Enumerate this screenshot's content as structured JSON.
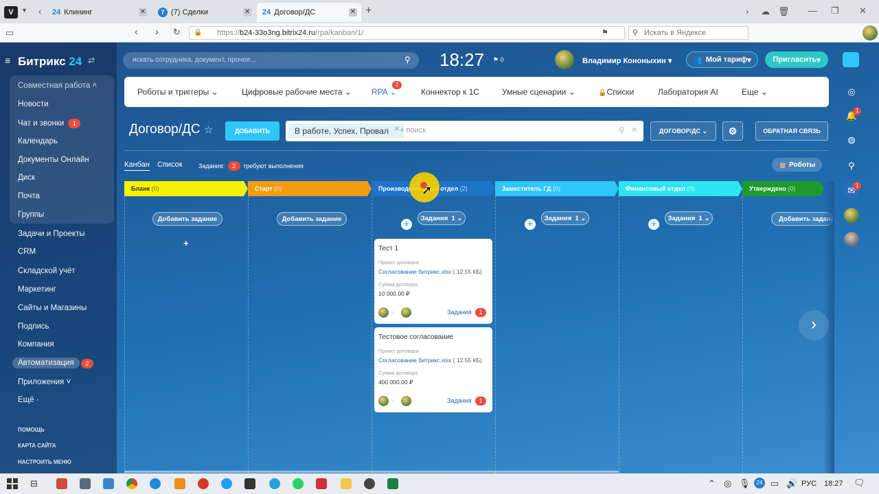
{
  "browser": {
    "tabs": [
      {
        "icon": "24",
        "label": "Клининг"
      },
      {
        "icon": "7",
        "label": "(7) Сделки"
      },
      {
        "icon": "24",
        "label": "Договор/ДС"
      }
    ],
    "url_prefix": "https://",
    "url_domain": "b24-33o3ng.bitrix24.ru",
    "url_path": "/rpa/kanban/1/",
    "search_placeholder": "Искать в Яндексе"
  },
  "app": {
    "logo_text": "Битрикс",
    "logo_num": "24",
    "search_placeholder": "искать сотрудника, документ, прочее...",
    "time": "18:27",
    "notif_count": "0",
    "user_name": "Владимир Кононыхин",
    "tariff": "Мой тариф",
    "invite": "Пригласить"
  },
  "sidebar": {
    "group_title": "Совместная работа",
    "group_items": [
      {
        "label": "Новости"
      },
      {
        "label": "Чат и звонки",
        "badge": "1"
      },
      {
        "label": "Календарь"
      },
      {
        "label": "Документы Онлайн"
      },
      {
        "label": "Диск"
      },
      {
        "label": "Почта"
      },
      {
        "label": "Группы"
      }
    ],
    "items": [
      {
        "label": "Задачи и Проекты"
      },
      {
        "label": "CRM"
      },
      {
        "label": "Складской учёт"
      },
      {
        "label": "Маркетинг"
      },
      {
        "label": "Сайты и Магазины"
      },
      {
        "label": "Подпись"
      },
      {
        "label": "Компания"
      },
      {
        "label": "Автоматизация",
        "badge": "2"
      },
      {
        "label": "Приложения"
      },
      {
        "label": "Ещё"
      }
    ],
    "bottom": [
      "ПОМОЩЬ",
      "КАРТА САЙТА",
      "НАСТРОИТЬ МЕНЮ"
    ]
  },
  "topnav": {
    "items": [
      "Роботы и триггеры",
      "Цифровые рабочие места",
      "RPA",
      "Коннектор к 1С",
      "Умные сценарии",
      "Списки",
      "Лаборатория AI",
      "Еще"
    ],
    "rpa_badge": "2"
  },
  "toolbar": {
    "title": "Договор/ДС",
    "add": "ДОБАВИТЬ",
    "filter_chip": "В работе, Успех, Провал",
    "filter_placeholder": "+ поиск",
    "dropdown": "ДОГОВОР/ДС",
    "feedback": "ОБРАТНАЯ СВЯЗЬ"
  },
  "views": {
    "kanban": "Канбан",
    "list": "Список",
    "tasks_label": "Задания:",
    "tasks_count": "2",
    "tasks_suffix": "требуют выполнения",
    "robots": "Роботы"
  },
  "stages": [
    {
      "name": "Бланк",
      "count": "(0)",
      "color": "#f7f300",
      "text": "#333"
    },
    {
      "name": "Старт",
      "count": "(0)",
      "color": "#f39c12",
      "text": "#fff"
    },
    {
      "name": "Производственный отдел",
      "count": "(2)",
      "color": "#1e74c9",
      "text": "#fff"
    },
    {
      "name": "Заместитель ГД",
      "count": "(0)",
      "color": "#2fc7f7",
      "text": "#fff"
    },
    {
      "name": "Финансовый отдел",
      "count": "(0)",
      "color": "#2fe3f3",
      "text": "#fff"
    },
    {
      "name": "Утверждено",
      "count": "(0)",
      "color": "#1f9a2e",
      "text": "#fff"
    }
  ],
  "column_actions": {
    "add_task": "Добавить задание",
    "tasks": "Задания",
    "tasks_count": "1"
  },
  "cards": [
    {
      "title": "Тест 1",
      "field1": "Проект договора",
      "file": "Согласование битрикс.xlsx",
      "size": "( 12.55 КБ)",
      "field2": "Сумма договора",
      "sum": "10 000.00 ₽",
      "tasks": "Задания",
      "count": "1"
    },
    {
      "title": "Тестовое согласование",
      "field1": "Проект договора",
      "file": "Согласование битрикс.xlsx",
      "size": "( 12.55 КБ)",
      "field2": "Сумма договора",
      "sum": "400 000.00 ₽",
      "tasks": "Задания",
      "count": "1"
    }
  ],
  "right_rail": {
    "notif_badge": "1",
    "chat_badge": "1"
  },
  "taskbar": {
    "lang": "РУС",
    "time": "18:27"
  },
  "colors": {
    "accent": "#2fc7f7",
    "badge": "#e84c3d",
    "cursor_highlight": "#f7d100"
  }
}
